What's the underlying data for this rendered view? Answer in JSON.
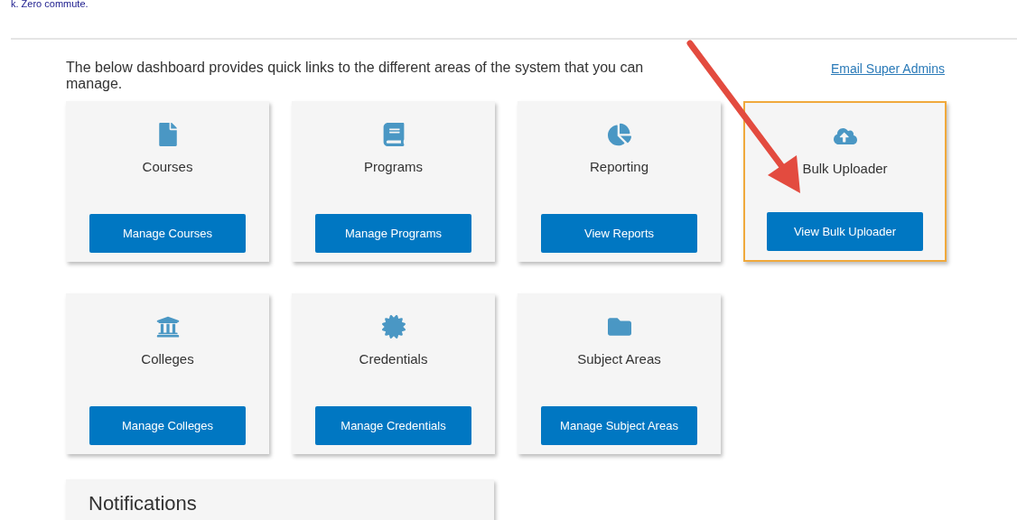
{
  "top_text": "k. Zero commute.",
  "intro": "The below dashboard provides quick links to the different areas of the system that you can manage.",
  "email_link": "Email Super Admins",
  "cards": [
    {
      "kind": "file",
      "title": "Courses",
      "button": "Manage Courses",
      "highlighted": false
    },
    {
      "kind": "book",
      "title": "Programs",
      "button": "Manage Programs",
      "highlighted": false
    },
    {
      "kind": "pie",
      "title": "Reporting",
      "button": "View Reports",
      "highlighted": false
    },
    {
      "kind": "cloud-upload",
      "title": "Bulk Uploader",
      "button": "View Bulk Uploader",
      "highlighted": true
    },
    {
      "kind": "building",
      "title": "Colleges",
      "button": "Manage Colleges",
      "highlighted": false
    },
    {
      "kind": "badge",
      "title": "Credentials",
      "button": "Manage Credentials",
      "highlighted": false
    },
    {
      "kind": "folder",
      "title": "Subject Areas",
      "button": "Manage Subject Areas",
      "highlighted": false
    }
  ],
  "notifications": {
    "title": "Notifications"
  }
}
